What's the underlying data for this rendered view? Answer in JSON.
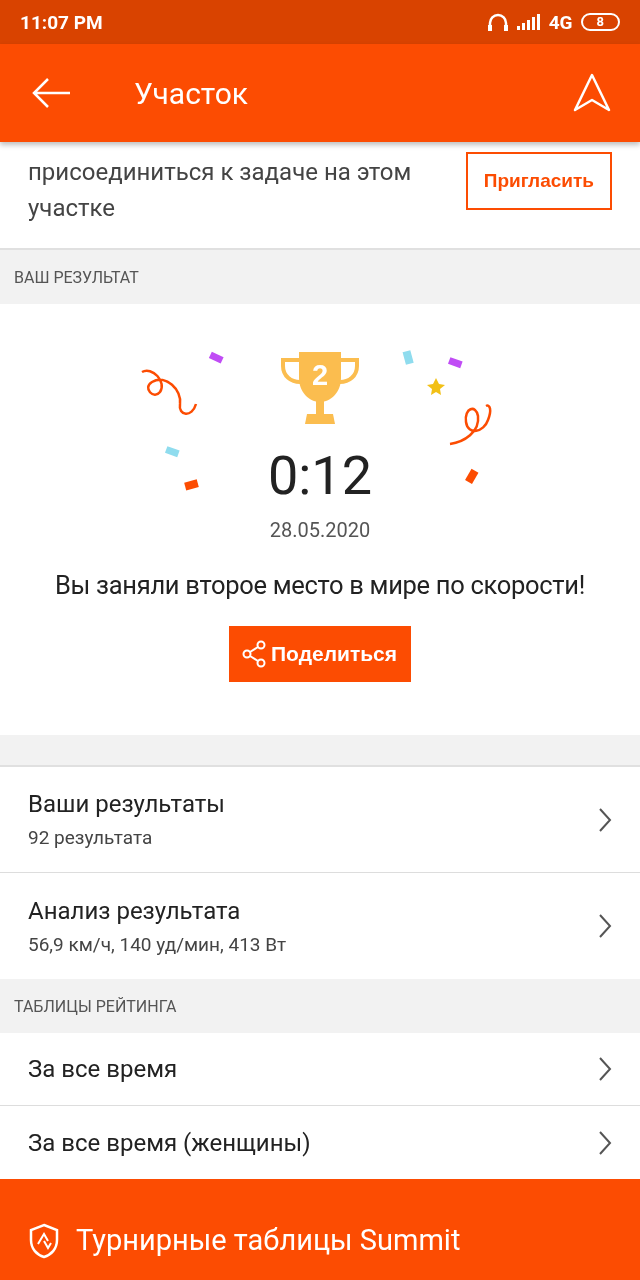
{
  "status_bar": {
    "time": "11:07 PM",
    "network": "4G",
    "battery": "8"
  },
  "app_bar": {
    "title": "Участок"
  },
  "invite": {
    "text": "присоединиться к задаче на этом участке",
    "button": "Пригласить"
  },
  "result_section": {
    "header": "ВАШ РЕЗУЛЬТАТ",
    "rank": "2",
    "time": "0:12",
    "date": "28.05.2020",
    "message": "Вы заняли второе место в мире по скорости!",
    "share_button": "Поделиться"
  },
  "result_rows": [
    {
      "title": "Ваши результаты",
      "subtitle": "92 результата"
    },
    {
      "title": "Анализ результата",
      "subtitle": "56,9 км/ч, 140 уд/мин, 413 Вт"
    }
  ],
  "leaderboards": {
    "header": "ТАБЛИЦЫ РЕЙТИНГА",
    "rows": [
      {
        "title": "За все время"
      },
      {
        "title": "За все время (женщины)"
      }
    ]
  },
  "banner": {
    "text": "Турнирные таблицы Summit"
  }
}
